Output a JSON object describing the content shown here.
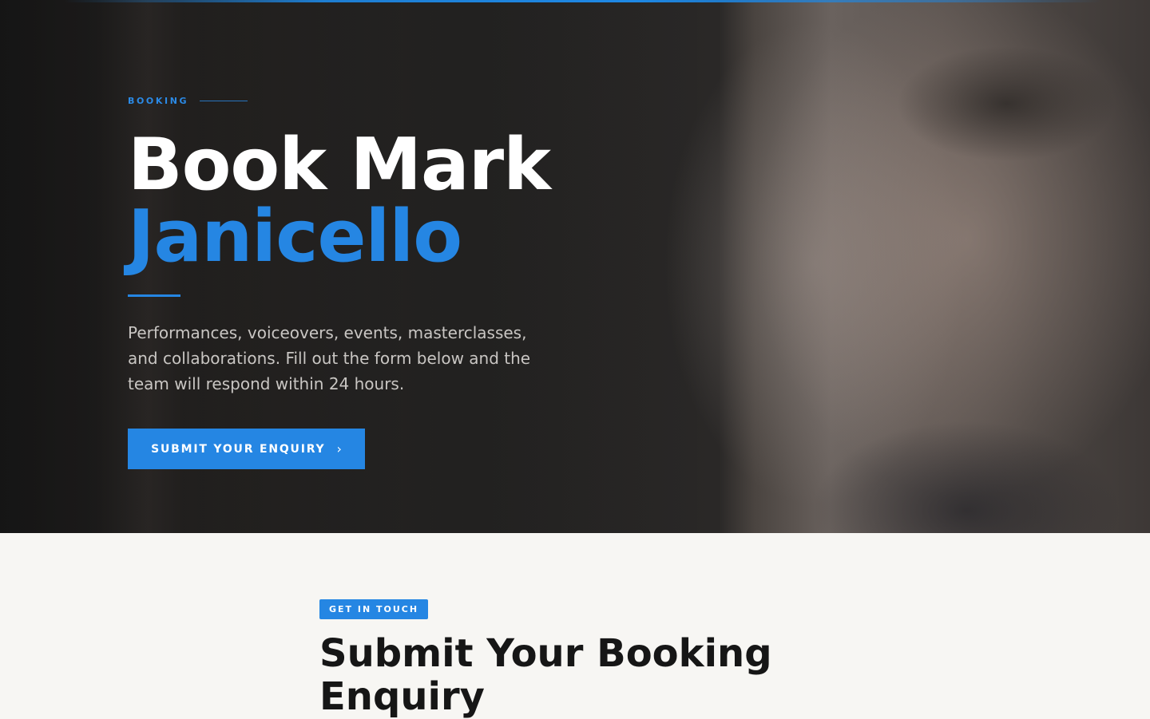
{
  "hero": {
    "eyebrow": "BOOKING",
    "title_line1": "Book Mark",
    "title_line2": "Janicello",
    "description": "Performances, voiceovers, events, masterclasses, and collaborations. Fill out the form below and the team will respond within 24 hours.",
    "cta_label": "SUBMIT YOUR ENQUIRY",
    "cta_icon": "chevron-right-icon"
  },
  "contact": {
    "badge": "GET IN TOUCH",
    "title": "Submit Your Booking Enquiry"
  },
  "colors": {
    "accent": "#2586e3",
    "hero_bg": "#201f1f",
    "section_bg": "#f7f6f3",
    "heading_dark": "#161616"
  }
}
